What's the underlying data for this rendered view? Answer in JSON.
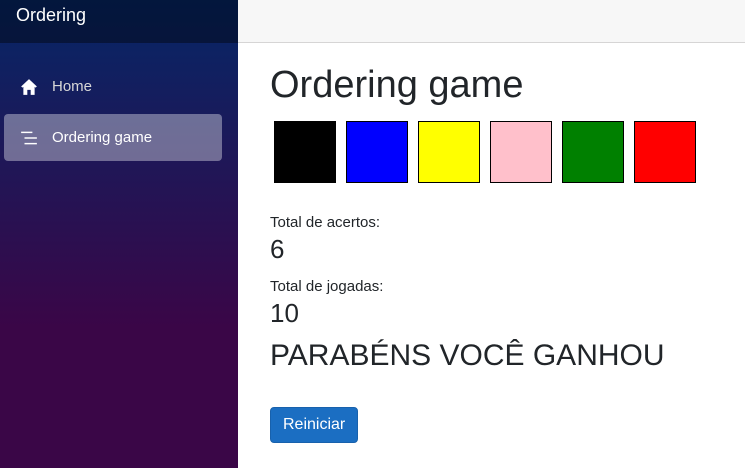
{
  "app": {
    "brand": "Ordering"
  },
  "nav": {
    "items": [
      {
        "label": "Home",
        "icon": "home-icon",
        "active": false
      },
      {
        "label": "Ordering game",
        "icon": "list-icon",
        "active": true
      }
    ]
  },
  "page": {
    "title": "Ordering game",
    "colors": [
      "#000000",
      "#0000ff",
      "#ffff00",
      "#ffc0cb",
      "#008000",
      "#ff0000"
    ],
    "stats": {
      "hits_label": "Total de acertos:",
      "hits_value": "6",
      "plays_label": "Total de jogadas:",
      "plays_value": "10"
    },
    "result_message": "PARABÉNS VOCÊ GANHOU",
    "restart_label": "Reiniciar"
  }
}
